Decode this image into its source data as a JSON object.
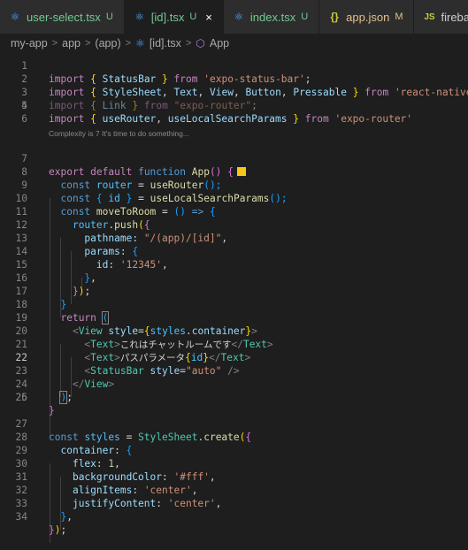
{
  "tabs": [
    {
      "name": "user-select.tsx",
      "status": "U",
      "icon": "react-icon",
      "active": false
    },
    {
      "name": "[id].tsx",
      "status": "U",
      "icon": "react-icon",
      "active": true,
      "close": "×"
    },
    {
      "name": "index.tsx",
      "status": "U",
      "icon": "react-icon",
      "active": false
    },
    {
      "name": "app.json",
      "status": "M",
      "icon": "json-icon",
      "active": false
    },
    {
      "name": "fireba",
      "status": "",
      "icon": "js-icon",
      "active": false
    }
  ],
  "breadcrumb": {
    "items": [
      "my-app",
      "app",
      "(app)",
      "[id].tsx",
      "App"
    ],
    "separator": ">"
  },
  "codelens": "Complexity is 7 It's time to do something...",
  "current_line": 22,
  "code": {
    "l1": [
      "import",
      "{",
      "StatusBar",
      "}",
      "from",
      "'expo-status-bar'",
      ";"
    ],
    "l2": [
      "import",
      "{",
      "StyleSheet",
      ",",
      "Text",
      ",",
      "View",
      ",",
      "Button",
      ",",
      "Pressable",
      "}",
      "from",
      "'react-native'",
      ";"
    ],
    "l3": [
      "import",
      "{",
      "Link",
      "}",
      "from",
      "\"expo-router\"",
      ";"
    ],
    "l4": [
      "import",
      "{",
      "useRouter",
      ",",
      "useLocalSearchParams",
      "}",
      "from",
      "'expo-router'"
    ],
    "l7": [
      "export",
      "default",
      "function",
      "App",
      "()",
      "{"
    ],
    "l8": [
      "const",
      "router",
      "=",
      "useRouter",
      "();"
    ],
    "l9": [
      "const",
      "{",
      "id",
      "}",
      "=",
      "useLocalSearchParams",
      "();"
    ],
    "l10": [
      "const",
      "moveToRoom",
      "=",
      "()",
      "=>",
      "{"
    ],
    "l11": [
      "router",
      ".",
      "push",
      "(",
      "{"
    ],
    "l12": [
      "pathname",
      ":",
      "\"/(app)/[id]\"",
      ","
    ],
    "l13": [
      "params",
      ":",
      "{"
    ],
    "l14": [
      "id",
      ":",
      "'12345'",
      ","
    ],
    "l15": [
      "}",
      ","
    ],
    "l16": [
      "}",
      ")",
      ";"
    ],
    "l17": [
      "}"
    ],
    "l18": [
      "return",
      "("
    ],
    "l19": [
      "<",
      "View",
      "style",
      "=",
      "{",
      "styles",
      ".",
      "container",
      "}",
      ">"
    ],
    "l20": [
      "<",
      "Text",
      ">",
      "これはチャットルームです",
      "</",
      "Text",
      ">"
    ],
    "l21": [
      "<",
      "Text",
      ">",
      "パスパラメータ",
      "{",
      "id",
      "}",
      "</",
      "Text",
      ">"
    ],
    "l22": [
      "<",
      "StatusBar",
      "style",
      "=",
      "\"auto\"",
      "/>"
    ],
    "l23": [
      "</",
      "View",
      ">"
    ],
    "l24": [
      ")",
      ";"
    ],
    "l25": [
      "}"
    ],
    "l27": [
      "const",
      "styles",
      "=",
      "StyleSheet",
      ".",
      "create",
      "(",
      "{"
    ],
    "l28": [
      "container",
      ":",
      "{"
    ],
    "l29": [
      "flex",
      ":",
      "1",
      ","
    ],
    "l30": [
      "backgroundColor",
      ":",
      "'#fff'",
      ","
    ],
    "l31": [
      "alignItems",
      ":",
      "'center'",
      ","
    ],
    "l32": [
      "justifyContent",
      ":",
      "'center'",
      ","
    ],
    "l33": [
      "}",
      ","
    ],
    "l34": [
      "}",
      ")",
      ";"
    ]
  },
  "colors": {
    "editor_bg": "#1e1e1e",
    "tabbar_bg": "#252526",
    "keyword": "#569cd6",
    "control": "#c586c0",
    "variable": "#9cdcfe",
    "function": "#dcdcaa",
    "string": "#ce9178",
    "type": "#4ec9b0",
    "git_untracked": "#73c991",
    "git_modified": "#e2c08d"
  }
}
